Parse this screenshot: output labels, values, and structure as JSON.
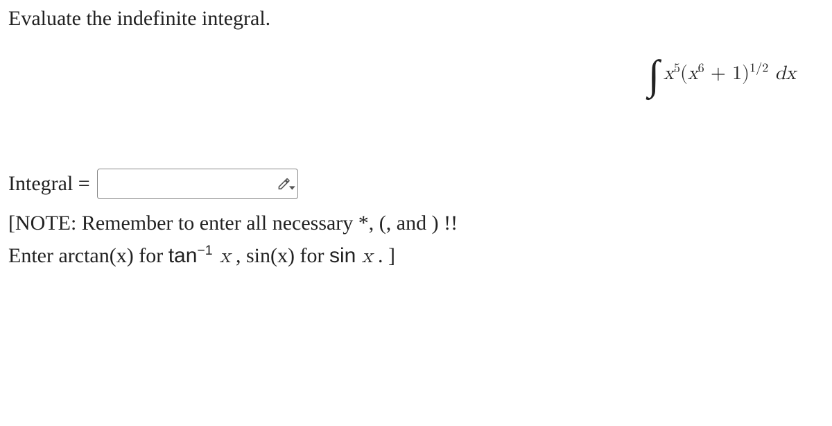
{
  "prompt": "Evaluate the indefinite integral.",
  "integral": {
    "base1": "x",
    "exp1": "5",
    "lparen": "(",
    "base2": "x",
    "exp2": "6",
    "plus": " + 1)",
    "exp3": "1/2",
    "dx_space": " ",
    "d": "d",
    "x": "x"
  },
  "answer_label": "Integral =",
  "answer_value": "",
  "note_line1_a": "[NOTE: Remember to enter all necessary *, (, and ) !!",
  "note_line2_a": "Enter arctan(x) for ",
  "note_tan": "tan",
  "note_tan_exp": "−1",
  "note_tan_x": " x",
  "note_sep": " , sin(x) for ",
  "note_sin": "sin ",
  "note_sin_x": "x",
  "note_end": " . ]"
}
